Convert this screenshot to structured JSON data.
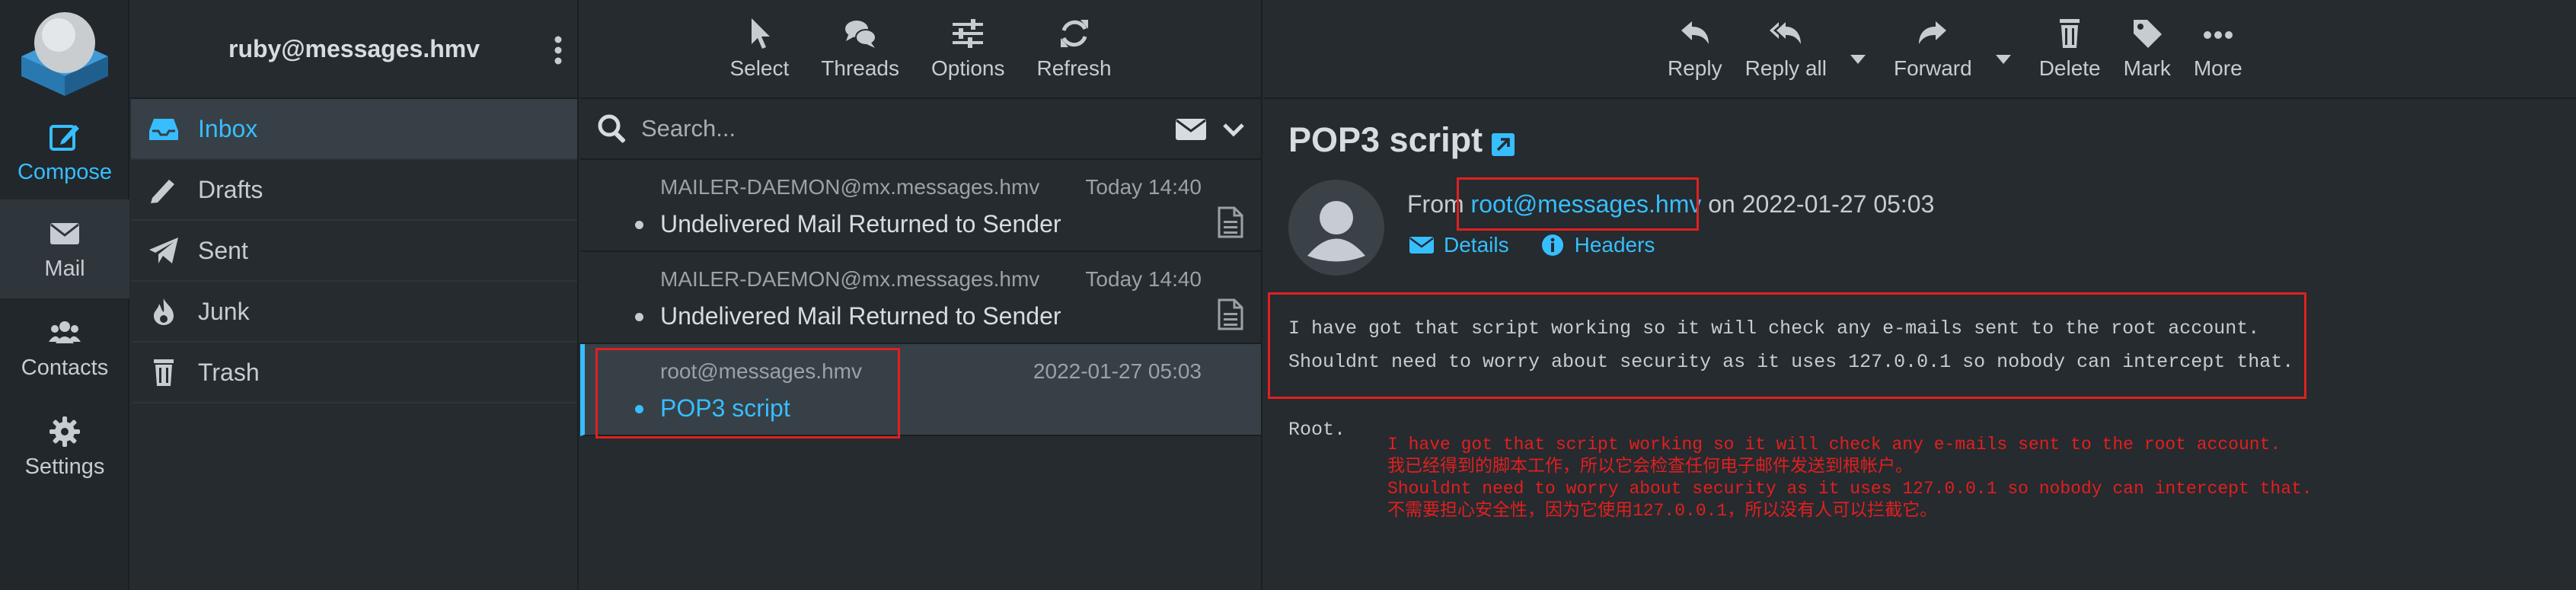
{
  "rail": {
    "compose": "Compose",
    "mail": "Mail",
    "contacts": "Contacts",
    "settings": "Settings"
  },
  "account": {
    "email": "ruby@messages.hmv"
  },
  "folders": [
    {
      "label": "Inbox",
      "icon": "inbox-icon",
      "selected": true
    },
    {
      "label": "Drafts",
      "icon": "pencil-icon"
    },
    {
      "label": "Sent",
      "icon": "paper-plane-icon"
    },
    {
      "label": "Junk",
      "icon": "fire-icon"
    },
    {
      "label": "Trash",
      "icon": "trash-icon"
    }
  ],
  "list_toolbar": {
    "select": "Select",
    "threads": "Threads",
    "options": "Options",
    "refresh": "Refresh"
  },
  "search": {
    "placeholder": "Search..."
  },
  "messages": [
    {
      "from": "MAILER-DAEMON@mx.messages.hmv",
      "date": "Today 14:40",
      "subject": "Undelivered Mail Returned to Sender",
      "attachment": true
    },
    {
      "from": "MAILER-DAEMON@mx.messages.hmv",
      "date": "Today 14:40",
      "subject": "Undelivered Mail Returned to Sender",
      "attachment": true
    },
    {
      "from": "root@messages.hmv",
      "date": "2022-01-27 05:03",
      "subject": "POP3 script",
      "selected": true
    }
  ],
  "reader_toolbar": {
    "reply": "Reply",
    "reply_all": "Reply all",
    "forward": "Forward",
    "delete": "Delete",
    "mark": "Mark",
    "more": "More"
  },
  "message": {
    "subject": "POP3 script",
    "from_prefix": "From",
    "from_address": "root@messages.hmv",
    "date_text": "on 2022-01-27 05:03",
    "details": "Details",
    "headers": "Headers",
    "body_line1": "I have got that script working so it will check any e-mails sent to the root account.",
    "body_line2": "Shouldnt need to worry about security as it uses 127.0.0.1 so nobody can intercept that.",
    "signature": "Root."
  },
  "annotation": {
    "line1": "I have got that script working so it will check any e-mails sent to the root account.",
    "line2": "我已经得到的脚本工作，所以它会检查任何电子邮件发送到根帐户。",
    "line3": "Shouldnt need to worry about security as it uses 127.0.0.1 so nobody can intercept that.",
    "line4": "不需要担心安全性，因为它使用127.0.0.1，所以没有人可以拦截它。"
  },
  "colors": {
    "accent": "#37beff",
    "background": "#252b2f",
    "highlight_box": "#e02020"
  }
}
